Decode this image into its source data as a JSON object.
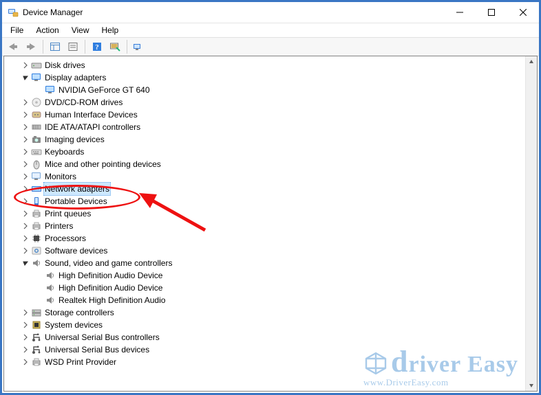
{
  "window": {
    "title": "Device Manager"
  },
  "menu": [
    "File",
    "Action",
    "View",
    "Help"
  ],
  "tree": [
    {
      "label": "Disk drives",
      "exp": "closed",
      "icon": "hdd",
      "depth": 1
    },
    {
      "label": "Display adapters",
      "exp": "open",
      "icon": "monitor-blue",
      "depth": 1
    },
    {
      "label": "NVIDIA GeForce GT 640",
      "exp": "none",
      "icon": "monitor-blue",
      "depth": 2
    },
    {
      "label": "DVD/CD-ROM drives",
      "exp": "closed",
      "icon": "optical",
      "depth": 1
    },
    {
      "label": "Human Interface Devices",
      "exp": "closed",
      "icon": "hid",
      "depth": 1
    },
    {
      "label": "IDE ATA/ATAPI controllers",
      "exp": "closed",
      "icon": "ata",
      "depth": 1
    },
    {
      "label": "Imaging devices",
      "exp": "closed",
      "icon": "camera",
      "depth": 1
    },
    {
      "label": "Keyboards",
      "exp": "closed",
      "icon": "keyboard",
      "depth": 1
    },
    {
      "label": "Mice and other pointing devices",
      "exp": "closed",
      "icon": "mouse",
      "depth": 1
    },
    {
      "label": "Monitors",
      "exp": "closed",
      "icon": "monitor",
      "depth": 1
    },
    {
      "label": "Network adapters",
      "exp": "closed",
      "icon": "network",
      "depth": 1,
      "selected": true
    },
    {
      "label": "Portable Devices",
      "exp": "closed",
      "icon": "portable",
      "depth": 1
    },
    {
      "label": "Print queues",
      "exp": "closed",
      "icon": "printer",
      "depth": 1
    },
    {
      "label": "Printers",
      "exp": "closed",
      "icon": "printer",
      "depth": 1
    },
    {
      "label": "Processors",
      "exp": "closed",
      "icon": "cpu",
      "depth": 1
    },
    {
      "label": "Software devices",
      "exp": "closed",
      "icon": "software",
      "depth": 1
    },
    {
      "label": "Sound, video and game controllers",
      "exp": "open",
      "icon": "speaker",
      "depth": 1
    },
    {
      "label": "High Definition Audio Device",
      "exp": "none",
      "icon": "speaker",
      "depth": 2
    },
    {
      "label": "High Definition Audio Device",
      "exp": "none",
      "icon": "speaker",
      "depth": 2
    },
    {
      "label": "Realtek High Definition Audio",
      "exp": "none",
      "icon": "speaker",
      "depth": 2
    },
    {
      "label": "Storage controllers",
      "exp": "closed",
      "icon": "storage",
      "depth": 1
    },
    {
      "label": "System devices",
      "exp": "closed",
      "icon": "chip",
      "depth": 1
    },
    {
      "label": "Universal Serial Bus controllers",
      "exp": "closed",
      "icon": "usb",
      "depth": 1
    },
    {
      "label": "Universal Serial Bus devices",
      "exp": "closed",
      "icon": "usb",
      "depth": 1
    },
    {
      "label": "WSD Print Provider",
      "exp": "closed",
      "icon": "printer",
      "depth": 1
    }
  ],
  "watermark": {
    "brand": "river Easy",
    "initial": "d",
    "url": "www.DriverEasy.com"
  }
}
